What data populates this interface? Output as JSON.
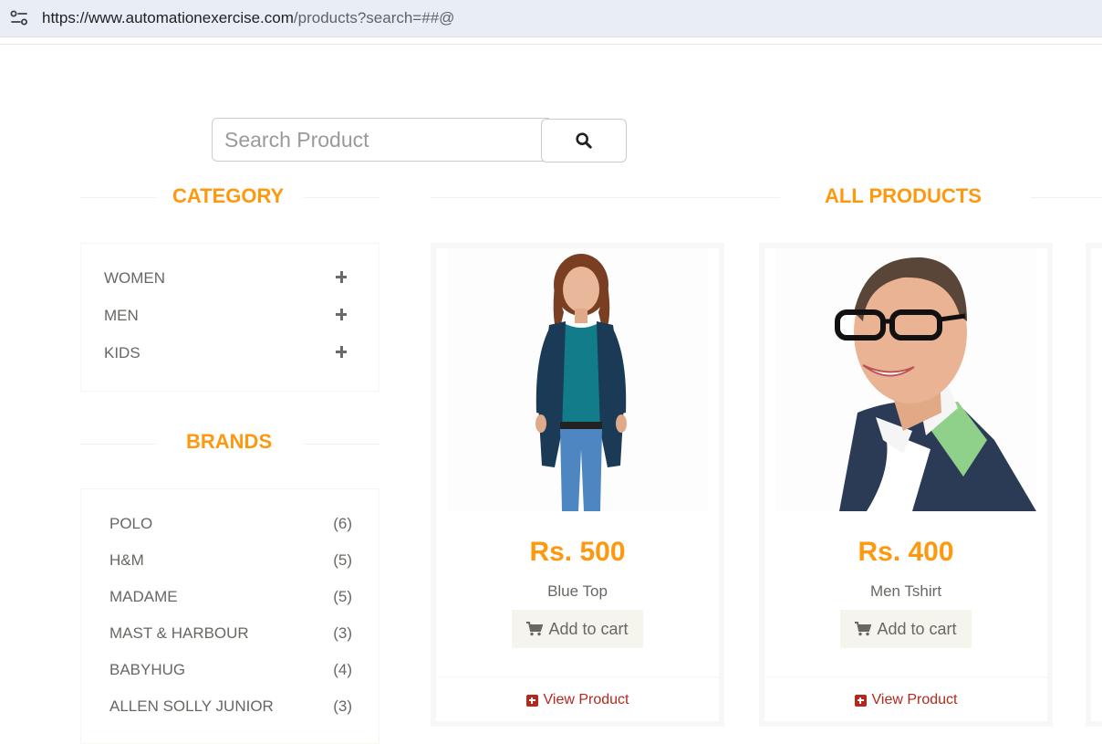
{
  "browser": {
    "url_host": "https://www.automationexercise.com",
    "url_path": "/products?search=##@"
  },
  "search": {
    "placeholder": "Search Product",
    "button_icon": "search-icon"
  },
  "sidebar": {
    "category_title": "CATEGORY",
    "categories": [
      {
        "label": "WOMEN",
        "icon": "plus-icon"
      },
      {
        "label": "MEN",
        "icon": "plus-icon"
      },
      {
        "label": "KIDS",
        "icon": "plus-icon"
      }
    ],
    "brands_title": "BRANDS",
    "brands": [
      {
        "name": "POLO",
        "count": "(6)"
      },
      {
        "name": "H&M",
        "count": "(5)"
      },
      {
        "name": "MADAME",
        "count": "(5)"
      },
      {
        "name": "MAST & HARBOUR",
        "count": "(3)"
      },
      {
        "name": "BABYHUG",
        "count": "(4)"
      },
      {
        "name": "ALLEN SOLLY JUNIOR",
        "count": "(3)"
      }
    ]
  },
  "main": {
    "title": "ALL PRODUCTS",
    "products": [
      {
        "price": "Rs. 500",
        "name": "Blue Top",
        "add_to_cart": "Add to cart",
        "view": "View Product"
      },
      {
        "price": "Rs. 400",
        "name": "Men Tshirt",
        "add_to_cart": "Add to cart",
        "view": "View Product"
      }
    ]
  },
  "colors": {
    "accent": "#FE980F",
    "link": "#B3291E",
    "text": "#696763"
  }
}
